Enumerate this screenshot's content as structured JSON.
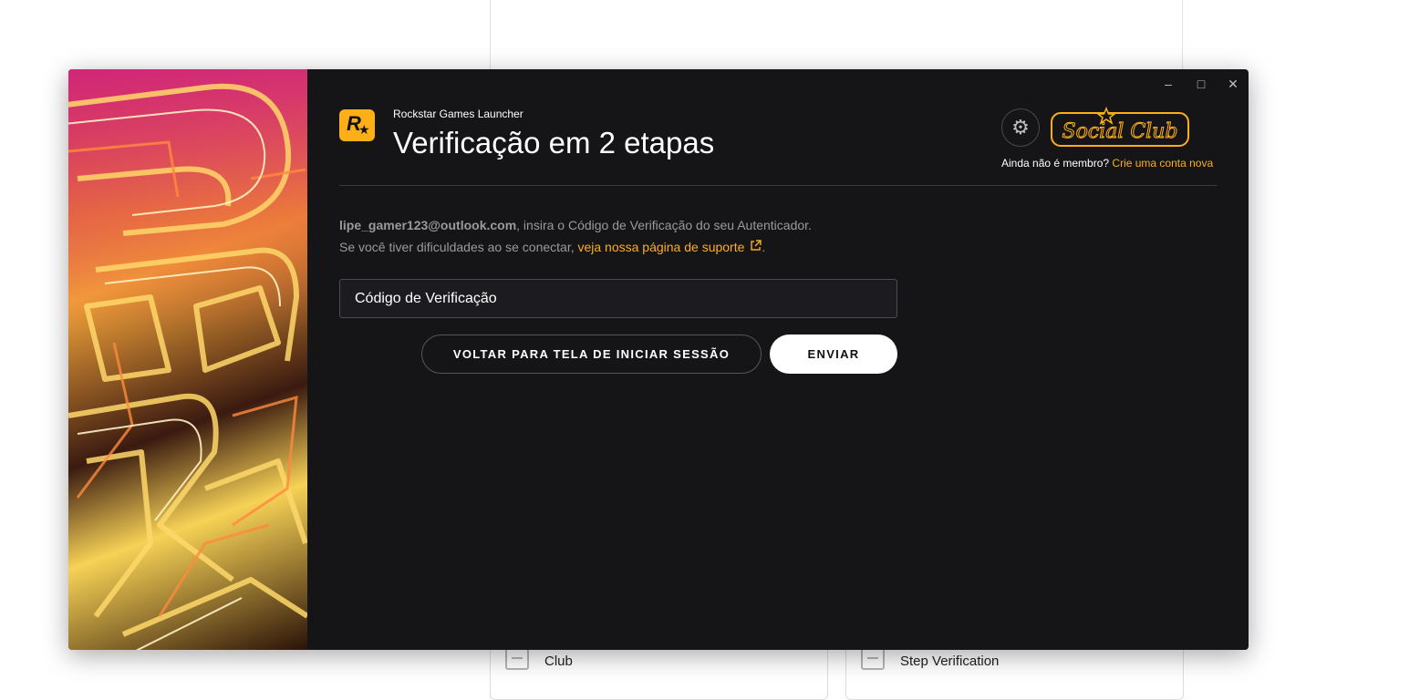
{
  "background_page": {
    "card_left_text": "Club",
    "card_right_text": "Step Verification"
  },
  "window": {
    "controls": {
      "minimize": "–",
      "maximize": "□",
      "close": "✕"
    },
    "app_name": "Rockstar Games Launcher",
    "page_title": "Verificação em 2 etapas",
    "logo_letter": "R",
    "social_club": {
      "logo_text": "Social Club",
      "member_prompt": "Ainda não é membro?",
      "create_account_link": "Crie uma conta nova"
    },
    "instructions": {
      "email": "lipe_gamer123@outlook.com",
      "line1_rest": ", insira o Código de Verificação do seu Autenticador.",
      "line2_prefix": "Se você tiver dificuldades ao se conectar, ",
      "support_link": "veja nossa página de suporte",
      "line2_suffix": "."
    },
    "code_input": {
      "placeholder": "Código de Verificação",
      "value": ""
    },
    "buttons": {
      "back": "VOLTAR PARA TELA DE INICIAR SESSÃO",
      "send": "ENVIAR"
    }
  },
  "icons": {
    "settings": "gear-icon",
    "external_link": "external-link-icon"
  },
  "colors": {
    "accent": "#fcaf17",
    "window_bg": "#151518",
    "text_muted": "#9a9a9e"
  }
}
